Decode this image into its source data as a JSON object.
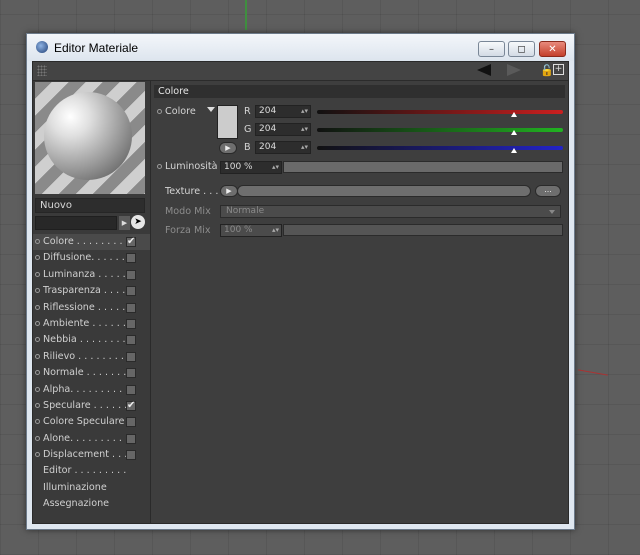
{
  "window": {
    "title": "Editor Materiale",
    "buttons": {
      "minimize": "–",
      "maximize": "◻",
      "close": "✕"
    }
  },
  "toolbar": {
    "new_label": "+"
  },
  "material": {
    "name": "Nuovo"
  },
  "channels": [
    {
      "label": "Colore . . . . . . . .",
      "checked": true,
      "active": true
    },
    {
      "label": "Diffusione. . . . . .",
      "checked": false
    },
    {
      "label": "Luminanza . . . . .",
      "checked": false
    },
    {
      "label": "Trasparenza . . . .",
      "checked": false
    },
    {
      "label": "Riflessione . . . . .",
      "checked": false
    },
    {
      "label": "Ambiente . . . . . .",
      "checked": false
    },
    {
      "label": "Nebbia . . . . . . . .",
      "checked": false
    },
    {
      "label": "Rilievo . . . . . . . .",
      "checked": false
    },
    {
      "label": "Normale . . . . . . .",
      "checked": false
    },
    {
      "label": "Alpha. . . . . . . . . .",
      "checked": false
    },
    {
      "label": "Speculare . . . . . .",
      "checked": true
    },
    {
      "label": "Colore Speculare",
      "checked": false
    },
    {
      "label": "Alone. . . . . . . . . .",
      "checked": false
    },
    {
      "label": "Displacement . . .",
      "checked": false
    },
    {
      "label": "Editor . . . . . . . . .",
      "checked": null
    },
    {
      "label": "Illuminazione",
      "checked": null
    },
    {
      "label": "Assegnazione",
      "checked": null
    }
  ],
  "color_section": {
    "header": "Colore",
    "color_label": "Colore",
    "swatch_color": "#cccccc",
    "r_label": "R",
    "g_label": "G",
    "b_label": "B",
    "r_value": "204",
    "g_value": "204",
    "b_value": "204",
    "r_level": 0.8,
    "g_level": 0.8,
    "b_level": 0.8,
    "brightness_label": "Luminosità",
    "brightness_value": "100 %",
    "texture_label": "Texture . . .",
    "texture_more": "...",
    "mix_mode_label": "Modo Mix",
    "mix_mode_value": "Normale",
    "mix_strength_label": "Forza Mix",
    "mix_strength_value": "100 %"
  },
  "colors": {
    "red_track": "#cc1f1f",
    "green_track": "#21b321",
    "blue_track": "#2323c8"
  }
}
